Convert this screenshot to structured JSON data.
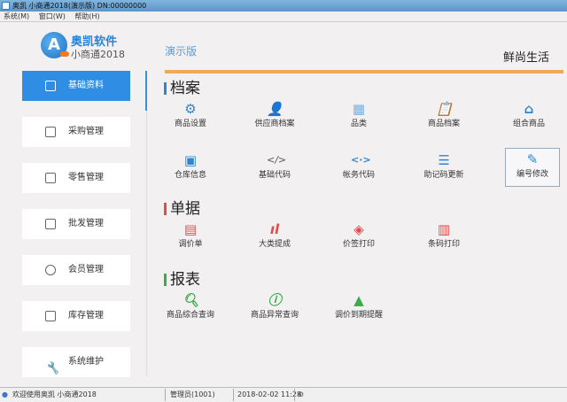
{
  "title": "奥凯 小商通2018(演示版) DN:00000000",
  "menu": [
    "系统(M)",
    "窗口(W)",
    "帮助(H)"
  ],
  "logo": {
    "brand": "奥凯软件",
    "product": "小商通2018"
  },
  "edition": "演示版",
  "store_name": "鲜尚生活",
  "sidebar": [
    {
      "label": "基础资料",
      "active": true
    },
    {
      "label": "采购管理"
    },
    {
      "label": "零售管理"
    },
    {
      "label": "批发管理"
    },
    {
      "label": "会员管理"
    },
    {
      "label": "库存管理"
    },
    {
      "label": "系统维护"
    }
  ],
  "sections": {
    "archive": {
      "title": "档案",
      "color": "#2d86cf",
      "items": [
        {
          "label": "商品设置",
          "icon": "gear-icon"
        },
        {
          "label": "供应商档案",
          "icon": "user-icon"
        },
        {
          "label": "品类",
          "icon": "grid-icon"
        },
        {
          "label": "商品档案",
          "icon": "clipboard-icon"
        },
        {
          "label": "组合商品",
          "icon": "basket-icon"
        },
        {
          "label": "仓库信息",
          "icon": "box-icon"
        },
        {
          "label": "基础代码",
          "icon": "code-icon"
        },
        {
          "label": "帐务代码",
          "icon": "code-arrows-icon"
        },
        {
          "label": "助记码更新",
          "icon": "list-icon"
        },
        {
          "label": "编号修改",
          "icon": "edit-icon"
        }
      ]
    },
    "docs": {
      "title": "单据",
      "color": "#e04c4c",
      "items": [
        {
          "label": "调价单",
          "icon": "document-icon"
        },
        {
          "label": "大类提成",
          "icon": "bar-chart-icon"
        },
        {
          "label": "价签打印",
          "icon": "tag-icon"
        },
        {
          "label": "条码打印",
          "icon": "barcode-icon"
        }
      ]
    },
    "reports": {
      "title": "报表",
      "color": "#3bab4c",
      "items": [
        {
          "label": "商品综合查询",
          "icon": "search-icon"
        },
        {
          "label": "商品异常查询",
          "icon": "search-alert-icon"
        },
        {
          "label": "调价到期提醒",
          "icon": "bell-icon"
        }
      ]
    }
  },
  "status": {
    "welcome": "欢迎使用奥凯 小商通2018",
    "user": "管理员(1001)",
    "datetime": "2018-02-02 11:28"
  }
}
